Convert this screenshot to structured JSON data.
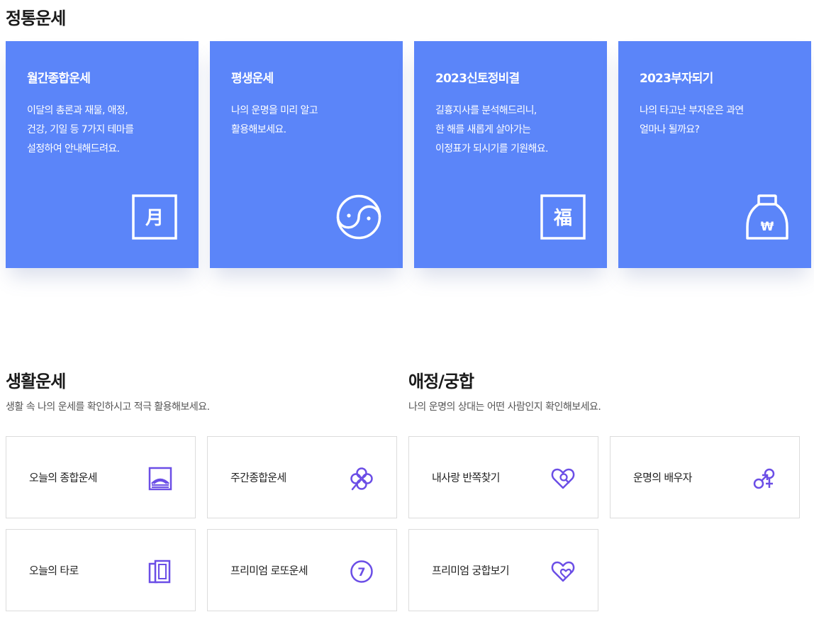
{
  "traditional": {
    "title": "정통운세",
    "cards": [
      {
        "title": "월간종합운세",
        "lines": [
          "이달의 총론과 재물, 애정,",
          "건강, 기일 등 7가지 테마를",
          "설정하여 안내해드려요."
        ],
        "icon": "moon-month-icon",
        "glyph": "月"
      },
      {
        "title": "평생운세",
        "lines": [
          "나의 운명을 미리 알고",
          "활용해보세요."
        ],
        "icon": "yin-yang-icon"
      },
      {
        "title": "2023신토정비결",
        "lines": [
          "길흉지사를 분석해드리니,",
          "한 해를 새롭게 살아가는",
          "이정표가 되시기를 기원해요."
        ],
        "icon": "fortune-bok-icon",
        "glyph": "福"
      },
      {
        "title": "2023부자되기",
        "lines": [
          "나의 타고난 부자운은 과연",
          "얼마나 될까요?"
        ],
        "icon": "money-bag-icon",
        "glyph": "₩"
      }
    ]
  },
  "life": {
    "title": "생활운세",
    "desc": "생활 속 나의 운세를 확인하시고 적극 활용해보세요.",
    "items": [
      {
        "label": "오늘의 종합운세",
        "icon": "sunrise-frame-icon"
      },
      {
        "label": "주간종합운세",
        "icon": "clover-icon"
      },
      {
        "label": "오늘의 타로",
        "icon": "tarot-cards-icon"
      },
      {
        "label": "프리미엄 로또운세",
        "icon": "lotto-ball-icon",
        "glyph": "7"
      }
    ]
  },
  "love": {
    "title": "애정/궁합",
    "desc": "나의 운명의 상대는 어떤 사람인지 확인해보세요.",
    "items": [
      {
        "label": "내사랑 반쪽찾기",
        "icon": "heart-search-icon"
      },
      {
        "label": "운명의 배우자",
        "icon": "gender-symbols-icon"
      },
      {
        "label": "프리미엄 궁합보기",
        "icon": "double-heart-icon"
      }
    ]
  },
  "colors": {
    "card_blue": "#5b85f9",
    "icon_purple": "#6b4ee6",
    "card_border": "#dcdcdc"
  }
}
